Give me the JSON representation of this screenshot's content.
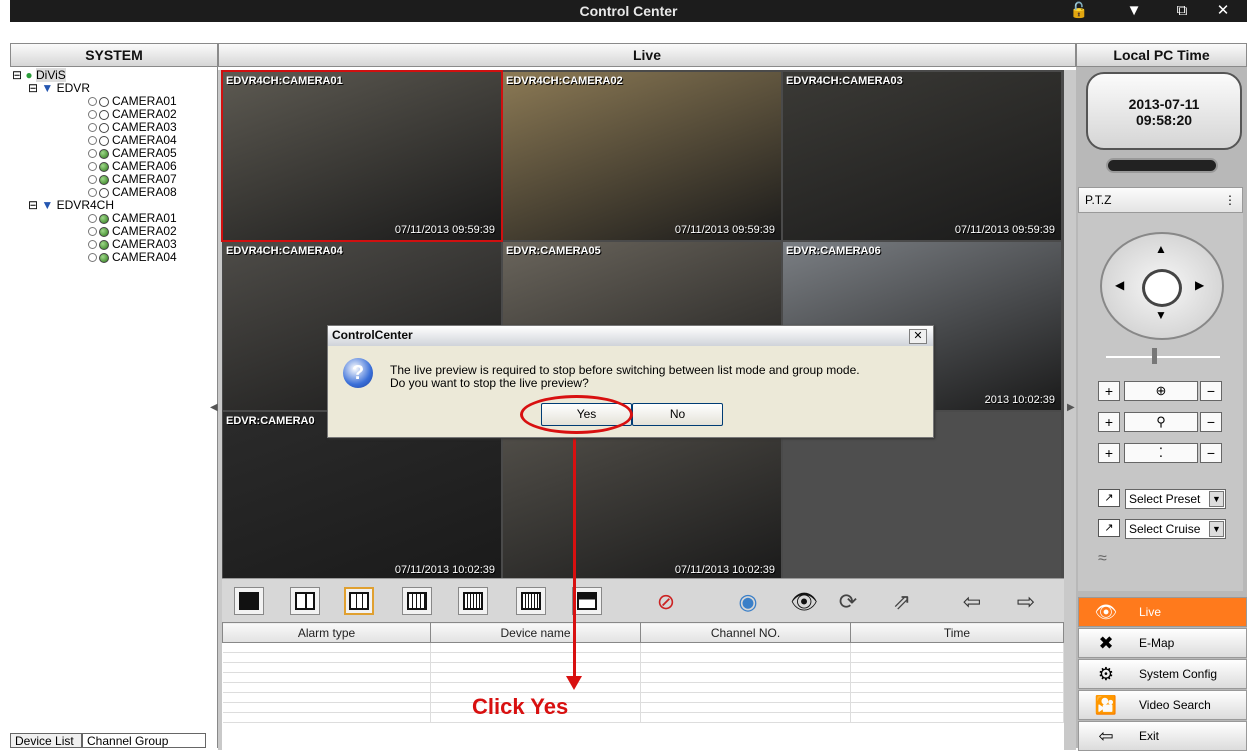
{
  "window": {
    "title": "Control Center"
  },
  "headers": {
    "system": "SYSTEM",
    "live": "Live",
    "localtime": "Local PC Time"
  },
  "tree": {
    "root": "DiViS",
    "groups": [
      {
        "name": "EDVR",
        "cameras": [
          {
            "name": "CAMERA01",
            "online": false
          },
          {
            "name": "CAMERA02",
            "online": false
          },
          {
            "name": "CAMERA03",
            "online": false
          },
          {
            "name": "CAMERA04",
            "online": false
          },
          {
            "name": "CAMERA05",
            "online": true
          },
          {
            "name": "CAMERA06",
            "online": true
          },
          {
            "name": "CAMERA07",
            "online": true
          },
          {
            "name": "CAMERA08",
            "online": false
          }
        ]
      },
      {
        "name": "EDVR4CH",
        "cameras": [
          {
            "name": "CAMERA01",
            "online": true
          },
          {
            "name": "CAMERA02",
            "online": true
          },
          {
            "name": "CAMERA03",
            "online": true
          },
          {
            "name": "CAMERA04",
            "online": true
          }
        ]
      }
    ]
  },
  "bottom_tabs": [
    "Device List",
    "Channel Group"
  ],
  "cells": [
    {
      "label": "EDVR4CH:CAMERA01",
      "timestamp": "07/11/2013 09:59:39",
      "bg": "#5d5a52"
    },
    {
      "label": "EDVR4CH:CAMERA02",
      "timestamp": "07/11/2013 09:59:39",
      "bg": "#8c7a55"
    },
    {
      "label": "EDVR4CH:CAMERA03",
      "timestamp": "07/11/2013 09:59:39",
      "bg": "#3b3a36"
    },
    {
      "label": "EDVR4CH:CAMERA04",
      "timestamp": "",
      "bg": "#4e4c48"
    },
    {
      "label": "EDVR:CAMERA05",
      "timestamp": "",
      "bg": "#6a655c"
    },
    {
      "label": "EDVR:CAMERA06",
      "timestamp": "2013 10:02:39",
      "bg": "#7b7f84"
    },
    {
      "label": "EDVR:CAMERA0",
      "timestamp": "07/11/2013 10:02:39",
      "bg": "#2b2b2b"
    },
    {
      "label": "",
      "timestamp": "07/11/2013 10:02:39",
      "bg": "#55524c"
    }
  ],
  "alarm": {
    "columns": [
      "Alarm type",
      "Device name",
      "Channel NO.",
      "Time"
    ]
  },
  "annotation": "Click Yes",
  "dialog": {
    "title": "ControlCenter",
    "line1": "The live preview is required to stop before switching between list mode and group mode.",
    "line2": "Do you want to stop the live preview?",
    "yes": "Yes",
    "no": "No"
  },
  "clock": {
    "date": "2013-07-11",
    "time": "09:58:20"
  },
  "ptz": {
    "label": "P.T.Z",
    "preset": "Select Preset",
    "cruise": "Select Cruise"
  },
  "nav": [
    {
      "label": "Live",
      "icon": "eye-icon",
      "active": true
    },
    {
      "label": "E-Map",
      "icon": "map-icon",
      "active": false
    },
    {
      "label": "System Config",
      "icon": "gear-icon",
      "active": false
    },
    {
      "label": "Video Search",
      "icon": "video-search-icon",
      "active": false
    },
    {
      "label": "Exit",
      "icon": "exit-icon",
      "active": false
    }
  ],
  "colors": {
    "accent": "#ff7a1c",
    "annotation": "#d81010"
  }
}
